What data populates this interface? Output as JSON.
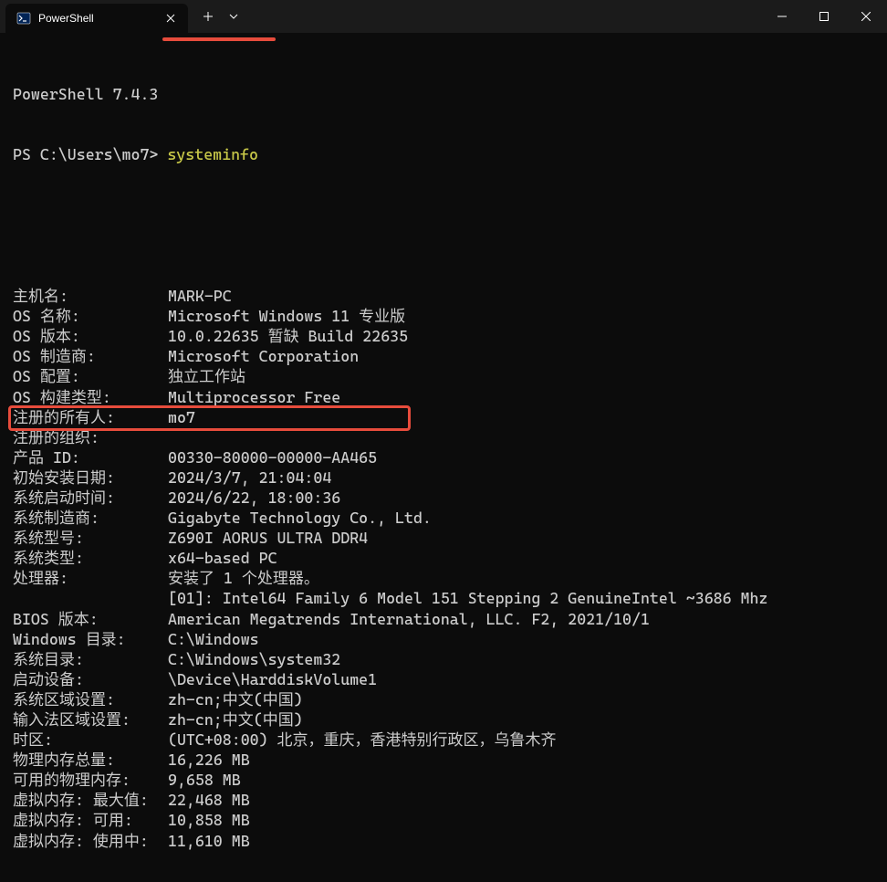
{
  "tab": {
    "title": "PowerShell"
  },
  "header": {
    "version": "PowerShell 7.4.3",
    "prompt_prefix": "PS ",
    "prompt_path": "C:\\Users\\mo7> ",
    "command": "systeminfo"
  },
  "info": [
    {
      "label": "主机名:",
      "value": "MARK-PC"
    },
    {
      "label": "OS 名称:",
      "value": "Microsoft Windows 11 专业版"
    },
    {
      "label": "OS 版本:",
      "value": "10.0.22635 暂缺 Build 22635"
    },
    {
      "label": "OS 制造商:",
      "value": "Microsoft Corporation"
    },
    {
      "label": "OS 配置:",
      "value": "独立工作站"
    },
    {
      "label": "OS 构建类型:",
      "value": "Multiprocessor Free"
    },
    {
      "label": "注册的所有人:",
      "value": "mo7"
    },
    {
      "label": "注册的组织:",
      "value": ""
    },
    {
      "label": "产品 ID:",
      "value": "00330-80000-00000-AA465"
    },
    {
      "label": "初始安装日期:",
      "value": "2024/3/7, 21:04:04"
    },
    {
      "label": "系统启动时间:",
      "value": "2024/6/22, 18:00:36"
    },
    {
      "label": "系统制造商:",
      "value": "Gigabyte Technology Co., Ltd."
    },
    {
      "label": "系统型号:",
      "value": "Z690I AORUS ULTRA DDR4"
    },
    {
      "label": "系统类型:",
      "value": "x64-based PC"
    },
    {
      "label": "处理器:",
      "value": "安装了 1 个处理器。"
    },
    {
      "label": "",
      "value": "[01]: Intel64 Family 6 Model 151 Stepping 2 GenuineIntel ~3686 Mhz"
    },
    {
      "label": "BIOS 版本:",
      "value": "American Megatrends International, LLC. F2, 2021/10/1"
    },
    {
      "label": "Windows 目录:",
      "value": "C:\\Windows"
    },
    {
      "label": "系统目录:",
      "value": "C:\\Windows\\system32"
    },
    {
      "label": "启动设备:",
      "value": "\\Device\\HarddiskVolume1"
    },
    {
      "label": "系统区域设置:",
      "value": "zh-cn;中文(中国)"
    },
    {
      "label": "输入法区域设置:",
      "value": "zh-cn;中文(中国)"
    },
    {
      "label": "时区:",
      "value": "(UTC+08:00) 北京，重庆，香港特别行政区，乌鲁木齐"
    },
    {
      "label": "物理内存总量:",
      "value": "16,226 MB"
    },
    {
      "label": "可用的物理内存:",
      "value": "9,658 MB"
    },
    {
      "label": "虚拟内存: 最大值:",
      "value": "22,468 MB"
    },
    {
      "label": "虚拟内存: 可用:",
      "value": "10,858 MB"
    },
    {
      "label": "虚拟内存: 使用中:",
      "value": "11,610 MB"
    }
  ]
}
